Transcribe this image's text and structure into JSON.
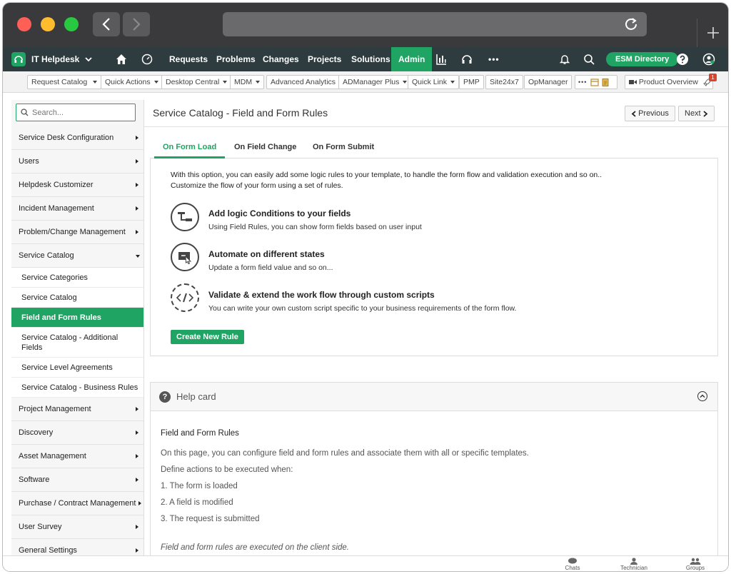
{
  "app": {
    "name": "IT Helpdesk",
    "nav": [
      "Requests",
      "Problems",
      "Changes",
      "Projects",
      "Solutions",
      "Admin"
    ],
    "active_nav": "Admin",
    "more": "•••",
    "esm_label": "ESM Directory"
  },
  "quickbar": {
    "items": [
      "Request Catalog",
      "Quick Actions",
      "Desktop Central",
      "MDM",
      "Advanced Analytics",
      "ADManager Plus",
      "Quick Link",
      "PMP",
      "Site24x7",
      "OpManager"
    ],
    "more": "•••",
    "product_overview": "Product Overview",
    "badge": "1"
  },
  "sidebar": {
    "search_placeholder": "Search...",
    "items_top": [
      "Service Desk Configuration",
      "Users",
      "Helpdesk Customizer",
      "Incident Management",
      "Problem/Change Management",
      "Service Catalog"
    ],
    "sub_items": [
      "Service Categories",
      "Service Catalog",
      "Field and Form Rules",
      "Service Catalog - Additional Fields",
      "Service Level Agreements",
      "Service Catalog - Business Rules"
    ],
    "items_bottom": [
      "Project Management",
      "Discovery",
      "Asset Management",
      "Software",
      "Purchase / Contract Management",
      "User Survey",
      "General Settings"
    ]
  },
  "main": {
    "title": "Service Catalog - Field and Form Rules",
    "previous": "Previous",
    "next": "Next",
    "tabs": [
      "On Form Load",
      "On Field Change",
      "On Form Submit"
    ],
    "intro_line1": "With this option, you can easily add some logic rules to your template, to handle the form flow and validation execution and so on..",
    "intro_line2": "Customize the flow of your form using a set of rules.",
    "features": [
      {
        "title": "Add logic Conditions to your fields",
        "desc": "Using Field Rules, you can show form fields based on user input"
      },
      {
        "title": "Automate on different states",
        "desc": "Update a form field value and so on..."
      },
      {
        "title": "Validate & extend the work flow through custom scripts",
        "desc": "You can write your own custom script specific to your business requirements of the form flow."
      }
    ],
    "create_button": "Create New Rule"
  },
  "help": {
    "title": "Help card",
    "subtitle": "Field and Form Rules",
    "p1": "On this page, you can configure field and form rules and associate them with all or specific templates.",
    "p2": "Define actions to be executed when:",
    "list": [
      "1. The form is loaded",
      "2. A field is modified",
      "3. The request is submitted"
    ],
    "note": "Field and form rules are executed on the client side."
  },
  "bottombar": {
    "chats": "Chats",
    "technician": "Technician",
    "groups": "Groups"
  },
  "colors": {
    "accent": "#1fa463",
    "header": "#2e3b3f"
  }
}
